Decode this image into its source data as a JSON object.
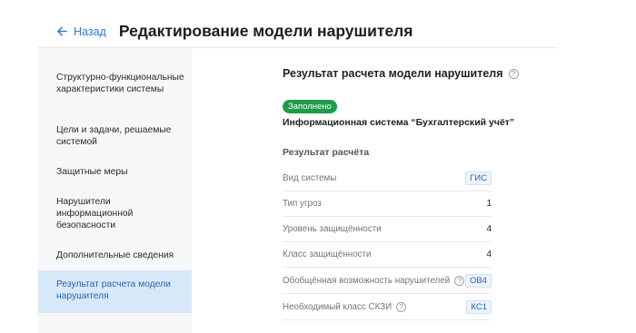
{
  "header": {
    "back_label": "Назад",
    "title": "Редактирование модели нарушителя"
  },
  "sidebar": {
    "items": [
      {
        "label": "Структурно-функциональные характеристики системы"
      },
      {
        "label": "Цели и задачи, решаемые системой"
      },
      {
        "label": "Защитные меры"
      },
      {
        "label": "Нарушители информационной безопасности"
      },
      {
        "label": "Дополнительные сведения"
      },
      {
        "label": "Результат расчета модели нарушителя"
      }
    ],
    "active_index": 5
  },
  "content": {
    "title": "Результат расчета модели нарушителя",
    "status_badge": "Заполнено",
    "system_name": "Информационная система “Бухгалтерский учёт”",
    "section_title": "Результат расчёта",
    "rows": [
      {
        "label": "Вид системы",
        "value": "ГИС",
        "style": "tag",
        "help": false
      },
      {
        "label": "Тип угроз",
        "value": "1",
        "style": "plain",
        "help": false
      },
      {
        "label": "Уровень защищённости",
        "value": "4",
        "style": "plain",
        "help": false
      },
      {
        "label": "Класс защищённости",
        "value": "4",
        "style": "plain",
        "help": false
      },
      {
        "label": "Обобщённая возможность нарушителей",
        "value": "ОВ4",
        "style": "tag",
        "help": true
      },
      {
        "label": "Необходимый класс СКЗИ",
        "value": "КС1",
        "style": "tag",
        "help": true
      }
    ]
  },
  "colors": {
    "accent": "#2d7ad6",
    "active_bg": "#d7e8f9",
    "badge_green": "#1f9c4a",
    "sidebar_bg": "#f6f7f9"
  },
  "icons": {
    "back": "arrow-left-icon",
    "help": "question-circle-icon"
  }
}
